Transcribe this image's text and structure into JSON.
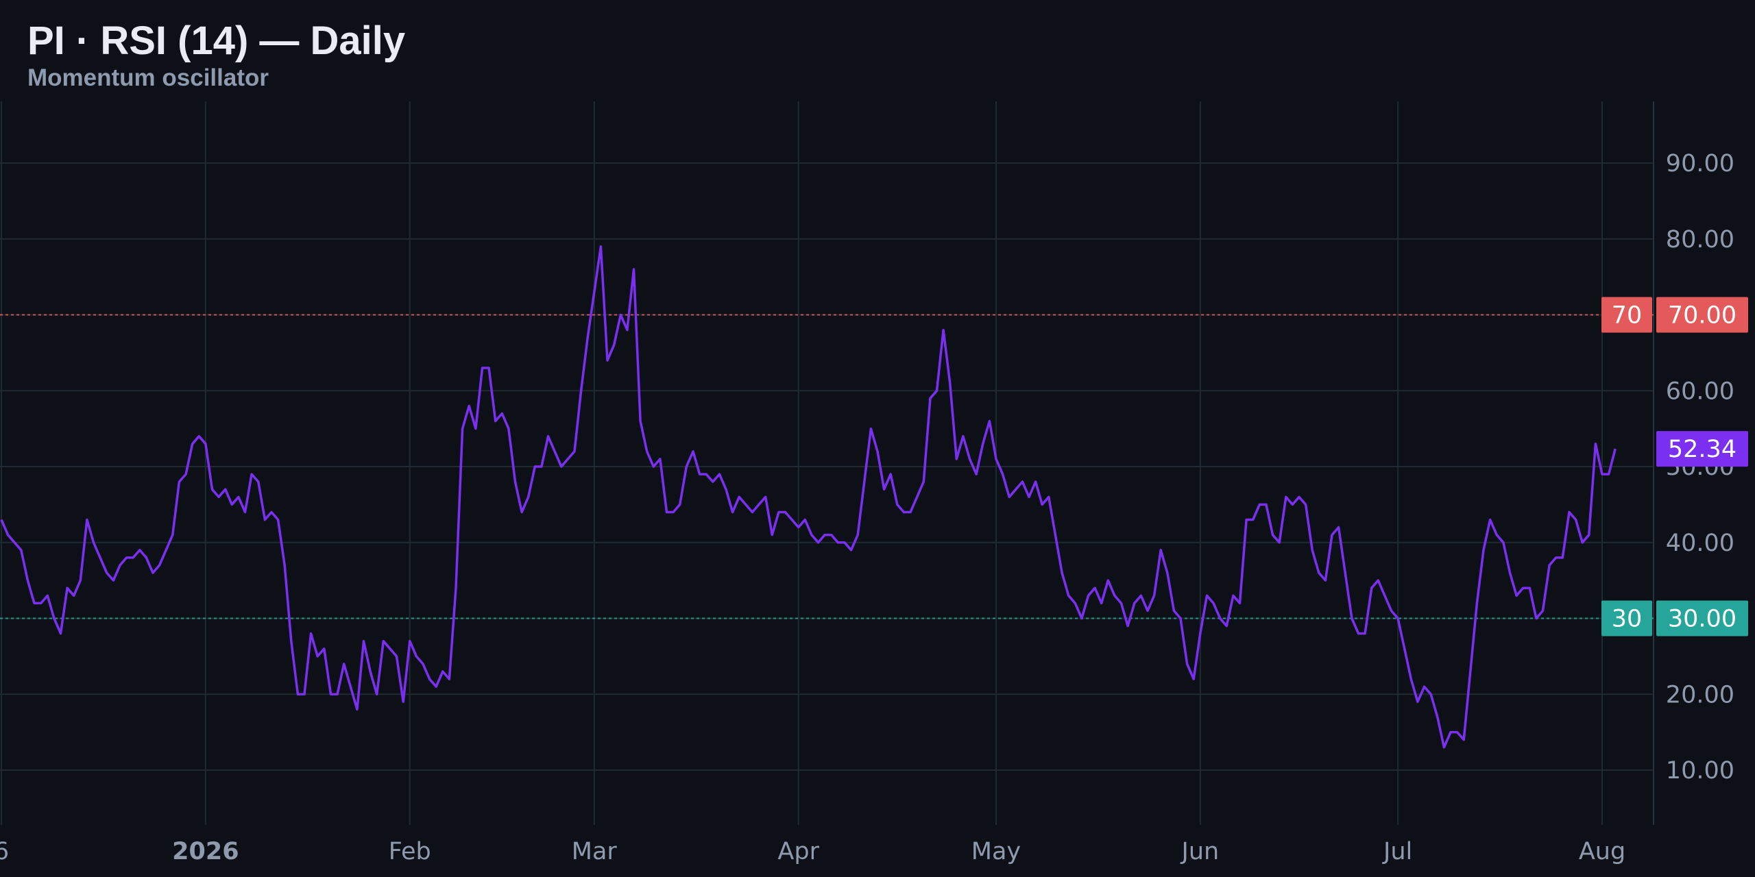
{
  "chart_data": {
    "type": "line",
    "title": "PI · RSI (14) — Daily",
    "subtitle": "Momentum oscillator",
    "xlabel": "",
    "ylabel": "",
    "ylim": [
      2.5,
      98.5
    ],
    "y_ticks": [
      "10.00",
      "20.00",
      "30.00",
      "40.00",
      "50.00",
      "60.00",
      "70.00",
      "80.00",
      "90.00"
    ],
    "x_ticks": [
      {
        "label": "6",
        "date": "2025-12-01"
      },
      {
        "label": "2026",
        "date": "2026-01-01",
        "bold": true
      },
      {
        "label": "Feb",
        "date": "2026-02-01"
      },
      {
        "label": "Mar",
        "date": "2026-03-01"
      },
      {
        "label": "Apr",
        "date": "2026-04-01"
      },
      {
        "label": "May",
        "date": "2026-05-01"
      },
      {
        "label": "Jun",
        "date": "2026-06-01"
      },
      {
        "label": "Jul",
        "date": "2026-07-01"
      },
      {
        "label": "Aug",
        "date": "2026-08-01"
      }
    ],
    "x_range": [
      "2025-12-01",
      "2026-08-09"
    ],
    "grid": true,
    "series": [
      {
        "color": "#7b2ff0",
        "start_date": "2025-12-01",
        "values": [
          43,
          41,
          40,
          39,
          35,
          32,
          32,
          33,
          30,
          28,
          34,
          33,
          35,
          43,
          40,
          38,
          36,
          35,
          37,
          38,
          38,
          39,
          38,
          36,
          37,
          39,
          41,
          48,
          49,
          53,
          54,
          53,
          47,
          46,
          47,
          45,
          46,
          44,
          49,
          48,
          43,
          44,
          43,
          37,
          27,
          20,
          20,
          28,
          25,
          26,
          20,
          20,
          24,
          21,
          18,
          27,
          23,
          20,
          27,
          26,
          25,
          19,
          27,
          25,
          24,
          22,
          21,
          23,
          22,
          34,
          55,
          58,
          55,
          63,
          63,
          56,
          57,
          55,
          48,
          44,
          46,
          50,
          50,
          54,
          52,
          50,
          51,
          52,
          60,
          67,
          73,
          79,
          64,
          66,
          70,
          68,
          76,
          56,
          52,
          50,
          51,
          44,
          44,
          45,
          50,
          52,
          49,
          49,
          48,
          49,
          47,
          44,
          46,
          45,
          44,
          45,
          46,
          41,
          44,
          44,
          43,
          42,
          43,
          41,
          40,
          41,
          41,
          40,
          40,
          39,
          41,
          48,
          55,
          52,
          47,
          49,
          45,
          44,
          44,
          46,
          48,
          59,
          60,
          68,
          61,
          51,
          54,
          51,
          49,
          53,
          56,
          51,
          49,
          46,
          47,
          48,
          46,
          48,
          45,
          46,
          41,
          36,
          33,
          32,
          30,
          33,
          34,
          32,
          35,
          33,
          32,
          29,
          32,
          33,
          31,
          33,
          39,
          36,
          31,
          30,
          24,
          22,
          28,
          33,
          32,
          30,
          29,
          33,
          32,
          43,
          43,
          45,
          45,
          41,
          40,
          46,
          45,
          46,
          45,
          39,
          36,
          35,
          41,
          42,
          36,
          30,
          28,
          28,
          34,
          35,
          33,
          31,
          30,
          26,
          22,
          19,
          21,
          20,
          17,
          13,
          15,
          15,
          14,
          23,
          32,
          39,
          43,
          41,
          40,
          36,
          33,
          34,
          34,
          30,
          31,
          37,
          38,
          38,
          44,
          43,
          40,
          41,
          53,
          49,
          49,
          52.34
        ]
      }
    ],
    "reference_lines": [
      {
        "value": 70,
        "label": "70",
        "axis_label": "70.00",
        "color": "#e45a5a",
        "style": "dotted"
      },
      {
        "value": 30,
        "label": "30",
        "axis_label": "30.00",
        "color": "#26a69a",
        "style": "dotted"
      }
    ],
    "last_value": {
      "label": "52.34",
      "value": 52.34,
      "color": "#7b2ff0"
    },
    "colors": {
      "background": "#0d1017",
      "grid": "#1f2a33",
      "axis_text": "#8f9bad",
      "line": "#7b2ff0"
    }
  }
}
